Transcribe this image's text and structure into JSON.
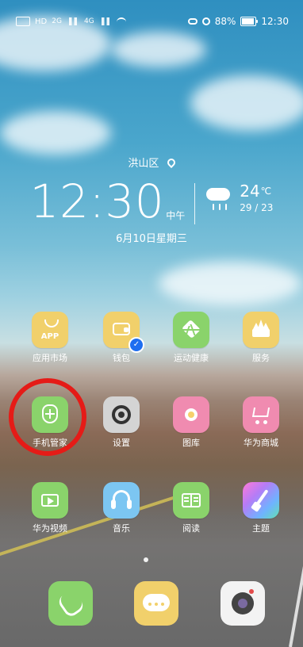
{
  "status_bar": {
    "network": "HD",
    "signal_1": "2G",
    "signal_2": "4G",
    "battery_percent": "88%",
    "time": "12:30"
  },
  "home": {
    "location": "洪山区",
    "time": "12:30",
    "ampm": "中午",
    "date": "6月10日星期三",
    "weather": {
      "temp": "24",
      "unit": "℃",
      "range": "29 / 23",
      "icon": "rain-cloud-icon"
    }
  },
  "apps": [
    {
      "label": "应用市场",
      "icon": "app-market-icon",
      "color": "#f1d06b"
    },
    {
      "label": "钱包",
      "icon": "wallet-icon",
      "color": "#f1d06b"
    },
    {
      "label": "运动健康",
      "icon": "health-heart-icon",
      "color": "#8ad36b"
    },
    {
      "label": "服务",
      "icon": "crown-icon",
      "color": "#f1d06b"
    },
    {
      "label": "手机管家",
      "icon": "shield-plus-icon",
      "color": "#8ad36b"
    },
    {
      "label": "设置",
      "icon": "gear-icon",
      "color": "#d4d4d4"
    },
    {
      "label": "图库",
      "icon": "flower-icon",
      "color": "#f08bb0"
    },
    {
      "label": "华为商城",
      "icon": "cart-icon",
      "color": "#f08bb0"
    },
    {
      "label": "华为视频",
      "icon": "video-play-icon",
      "color": "#8ad36b"
    },
    {
      "label": "音乐",
      "icon": "headphones-icon",
      "color": "#7cc6f2"
    },
    {
      "label": "阅读",
      "icon": "book-icon",
      "color": "#8ad36b"
    },
    {
      "label": "主题",
      "icon": "brush-icon",
      "color": "#c47cf2"
    }
  ],
  "dock": [
    {
      "icon": "phone-icon",
      "color": "#8ad36b"
    },
    {
      "icon": "messages-icon",
      "color": "#f1d06b"
    },
    {
      "icon": "camera-icon",
      "color": "#f3f3f3"
    }
  ],
  "extras": {
    "app_icon_text": "APP"
  }
}
